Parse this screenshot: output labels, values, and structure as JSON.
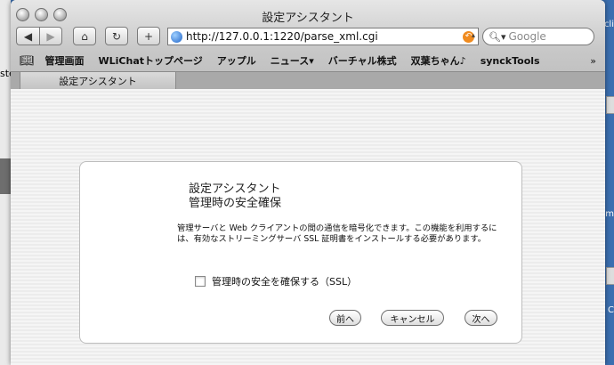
{
  "window": {
    "title": "設定アシスタント"
  },
  "desktop": {
    "left_text": "ste",
    "right_texts": [
      "cli",
      "m",
      "m",
      "C"
    ]
  },
  "toolbar": {
    "back_label": "◀",
    "forward_label": "▶",
    "home_label": "⌂",
    "reload_label": "↻",
    "add_label": "+",
    "url": "http://127.0.0.1:1220/parse_xml.cgi",
    "search_placeholder": "Google"
  },
  "bookmarks": {
    "book_icon": "book-icon",
    "items": [
      "管理画面",
      "WLiChatトップページ",
      "アップル",
      "ニュース▾",
      "バーチャル株式",
      "双葉ちゃん♪",
      "synckTools"
    ],
    "more": "»"
  },
  "tabs": [
    {
      "label": "設定アシスタント"
    }
  ],
  "dialog": {
    "title_line1": "設定アシスタント",
    "title_line2": "管理時の安全確保",
    "description": "管理サーバと Web クライアントの間の通信を暗号化できます。この機能を利用するには、有効なストリーミングサーバ SSL 証明書をインストールする必要があります。",
    "checkbox_label": "管理時の安全を確保する（SSL）",
    "checkbox_checked": false,
    "buttons": {
      "back": "前へ",
      "cancel": "キャンセル",
      "next": "次へ"
    }
  }
}
